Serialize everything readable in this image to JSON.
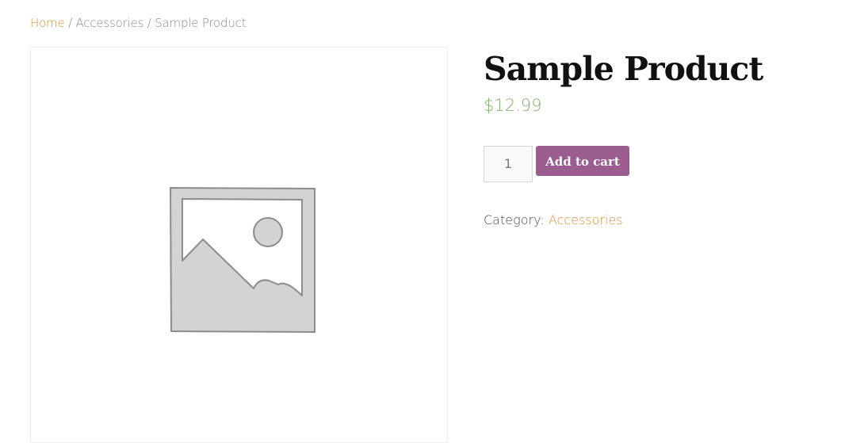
{
  "breadcrumb": {
    "home": "Home",
    "separator": " / ",
    "category": "Accessories",
    "current": "Sample Product"
  },
  "product": {
    "title": "Sample Product",
    "price": "$12.99",
    "quantity": "1",
    "add_to_cart_label": "Add to cart",
    "category_label": "Category:",
    "category_value": "Accessories",
    "image_icon": "image-placeholder-icon"
  },
  "colors": {
    "link": "#d88f3b",
    "price": "#86b36d",
    "button": "#9b5c8f",
    "title": "#111111"
  }
}
